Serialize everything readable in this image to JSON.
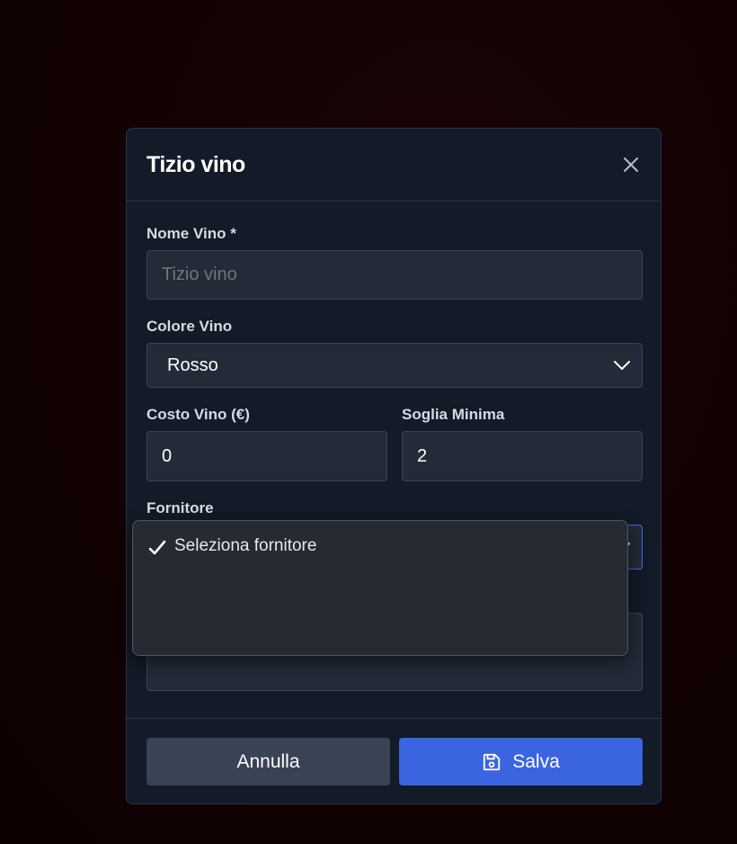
{
  "modal": {
    "title": "Tizio vino",
    "close_icon": "close-icon"
  },
  "form": {
    "nome_vino": {
      "label": "Nome Vino *",
      "value": "",
      "placeholder": "Tizio vino"
    },
    "colore_vino": {
      "label": "Colore Vino",
      "selected": "Rosso"
    },
    "costo_vino": {
      "label": "Costo Vino (€)",
      "value": "0"
    },
    "soglia_minima": {
      "label": "Soglia Minima",
      "value": "2"
    },
    "fornitore": {
      "label": "Fornitore",
      "options": [
        {
          "label": "Seleziona fornitore",
          "selected": true
        }
      ]
    }
  },
  "footer": {
    "cancel_label": "Annulla",
    "save_label": "Salva",
    "save_icon": "floppy-disk-icon"
  },
  "colors": {
    "accent": "#3b64e0",
    "modal_bg": "#131a28",
    "input_bg": "#232a38"
  }
}
